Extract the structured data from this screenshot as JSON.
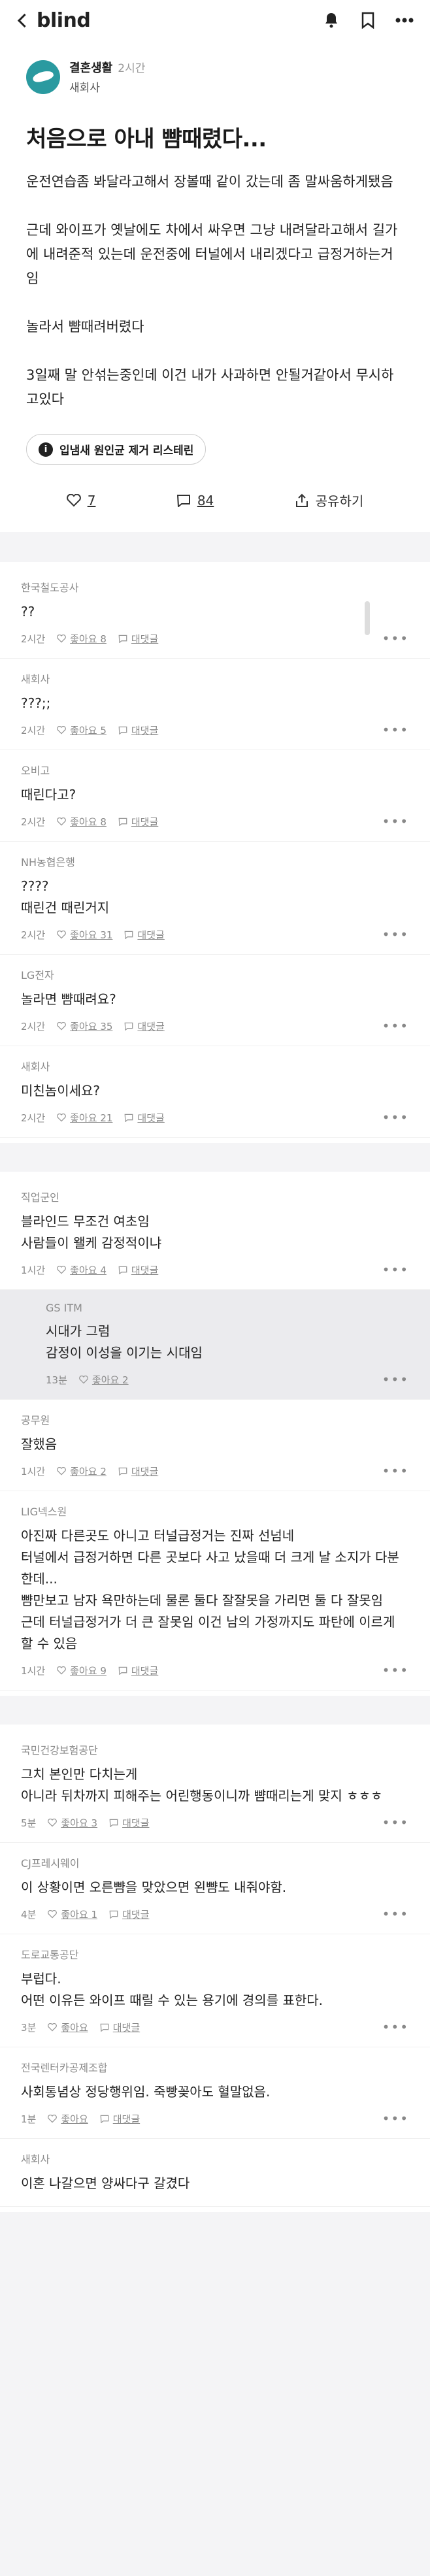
{
  "topbar": {
    "logo": "blind"
  },
  "post": {
    "company": "결혼생활",
    "time": "2시간",
    "subtitle": "새회사",
    "title": "처음으로 아내 뺨때렸다...",
    "body": "운전연습좀 봐달라고해서 장볼때 같이 갔는데 좀 말싸움하게됐음\n\n근데 와이프가 옛날에도 차에서 싸우면 그냥 내려달라고해서 길가에 내려준적 있는데 운전중에 터널에서 내리겠다고 급정거하는거임\n\n놀라서 뺨때려버렸다\n\n3일째 말 안섞는중인데 이건 내가 사과하면 안될거같아서 무시하고있다",
    "tag": "입냄새 원인균 제거 리스테린",
    "likes": "7",
    "comments": "84",
    "share": "공유하기"
  },
  "comments_a": [
    {
      "company": "한국철도공사",
      "text": "??",
      "time": "2시간",
      "like": "좋아요 8",
      "reply": "대댓글"
    },
    {
      "company": "새회사",
      "text": "???;;",
      "time": "2시간",
      "like": "좋아요 5",
      "reply": "대댓글"
    },
    {
      "company": "오비고",
      "text": "때린다고?",
      "time": "2시간",
      "like": "좋아요 8",
      "reply": "대댓글"
    },
    {
      "company": "NH농협은행",
      "text": "????\n때린건 때린거지",
      "time": "2시간",
      "like": "좋아요 31",
      "reply": "대댓글"
    },
    {
      "company": "LG전자",
      "text": "놀라면 뺨때려요?",
      "time": "2시간",
      "like": "좋아요 35",
      "reply": "대댓글"
    },
    {
      "company": "새회사",
      "text": "미친놈이세요?",
      "time": "2시간",
      "like": "좋아요 21",
      "reply": "대댓글"
    }
  ],
  "comments_b": [
    {
      "company": "직업군인",
      "text": "블라인드 무조건 여초임\n사람들이 왤케 감정적이냐",
      "time": "1시간",
      "like": "좋아요 4",
      "reply": "대댓글",
      "isReply": false
    },
    {
      "company": "GS ITM",
      "text": "시대가 그럼\n감정이 이성을 이기는 시대임",
      "time": "13분",
      "like": "좋아요 2",
      "reply": "",
      "isReply": true
    },
    {
      "company": "공무원",
      "text": "잘했음",
      "time": "1시간",
      "like": "좋아요 2",
      "reply": "대댓글",
      "isReply": false
    },
    {
      "company": "LIG넥스원",
      "text": "아진짜 다른곳도 아니고 터널급정거는 진짜 선넘네\n터널에서 급정거하면 다른 곳보다 사고 났을때 더 크게 날 소지가 다분한데...\n뺨만보고 남자 욕만하는데 물론 둘다 잘잘못을 가리면 둘 다 잘못임\n근데 터널급정거가 더 큰 잘못임 이건 남의 가정까지도 파탄에 이르게 할 수 있음",
      "time": "1시간",
      "like": "좋아요 9",
      "reply": "대댓글",
      "isReply": false
    }
  ],
  "comments_c": [
    {
      "company": "국민건강보험공단",
      "text": "그치 본인만 다치는게\n아니라 뒤차까지 피해주는 어린행동이니까 뺨때리는게 맞지 ㅎㅎㅎ",
      "time": "5분",
      "like": "좋아요 3",
      "reply": "대댓글"
    },
    {
      "company": "CJ프레시웨이",
      "text": "이 상황이면 오른뺨을 맞았으면 왼뺨도 내줘야함.",
      "time": "4분",
      "like": "좋아요 1",
      "reply": "대댓글"
    },
    {
      "company": "도로교통공단",
      "text": "부럽다.\n어떤 이유든 와이프 때릴 수 있는 용기에 경의를 표한다.",
      "time": "3분",
      "like": "좋아요",
      "reply": "대댓글"
    },
    {
      "company": "전국렌터카공제조합",
      "text": "사회통념상 정당행위임. 죽빵꽂아도 혈말없음.",
      "time": "1분",
      "like": "좋아요",
      "reply": "대댓글"
    },
    {
      "company": "새회사",
      "text": "이혼 나갈으면 양싸다구 갈겼다",
      "time": "",
      "like": "",
      "reply": ""
    }
  ]
}
